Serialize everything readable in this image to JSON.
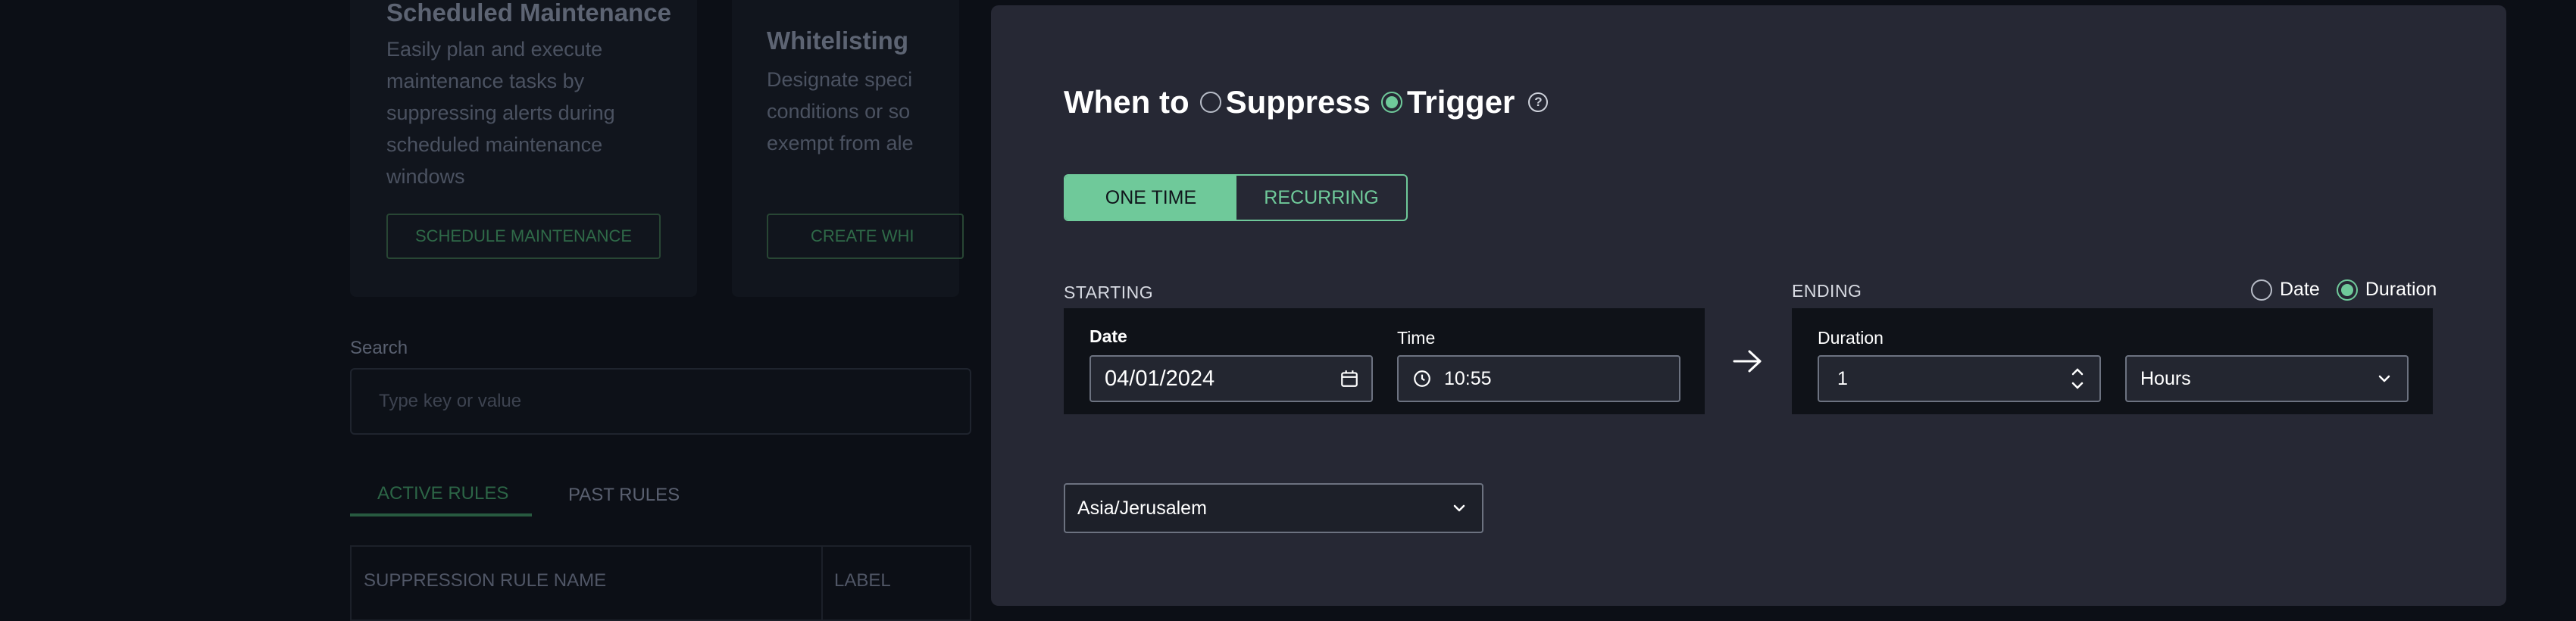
{
  "background": {
    "cards": [
      {
        "title": "Scheduled Maintenance",
        "description": "Easily plan and execute maintenance tasks by suppressing alerts during scheduled maintenance windows",
        "button": "SCHEDULE MAINTENANCE"
      },
      {
        "title": "Whitelisting",
        "description": "Designate speci conditions or so exempt from ale",
        "button": "CREATE WHI"
      }
    ],
    "search": {
      "label": "Search",
      "placeholder": "Type key or value"
    },
    "tabs": {
      "active": "ACTIVE RULES",
      "past": "PAST RULES"
    },
    "table": {
      "headers": [
        "SUPPRESSION RULE NAME",
        "LABEL"
      ]
    }
  },
  "modal": {
    "when": {
      "label": "When to",
      "suppress": "Suppress",
      "trigger": "Trigger",
      "selected": "trigger",
      "help_icon": "question-circle-icon"
    },
    "schedule_type": {
      "one_time": "ONE TIME",
      "recurring": "RECURRING",
      "selected": "one_time"
    },
    "starting": {
      "label": "STARTING",
      "date_label": "Date",
      "date_value": "04/01/2024",
      "date_icon": "calendar-icon",
      "time_label": "Time",
      "time_value": "10:55",
      "time_icon": "clock-icon"
    },
    "arrow_icon": "arrow-right-icon",
    "ending": {
      "label": "ENDING",
      "mode_date": "Date",
      "mode_duration": "Duration",
      "selected_mode": "duration",
      "duration_label": "Duration",
      "duration_value": "1",
      "unit_value": "Hours"
    },
    "timezone": {
      "value": "Asia/Jerusalem"
    }
  },
  "colors": {
    "accent": "#6fc99a",
    "modal_bg": "#262834",
    "page_bg": "#0c0f16"
  }
}
